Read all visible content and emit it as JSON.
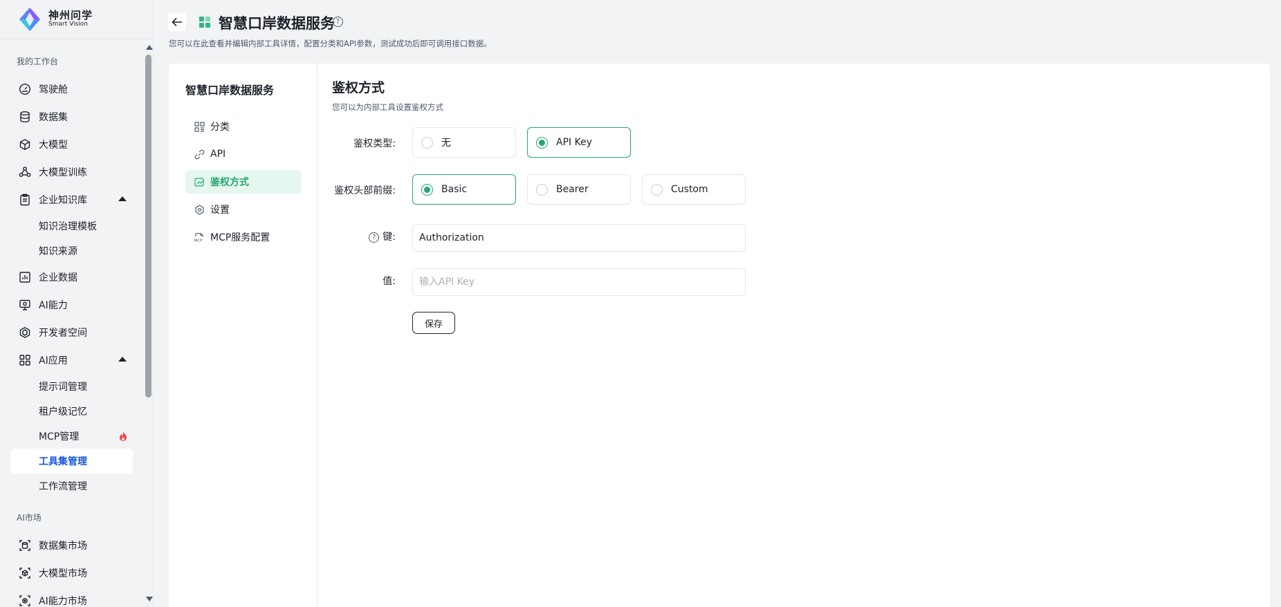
{
  "brand": {
    "name_cn": "神州问学",
    "name_en": "Smart Vision"
  },
  "sidebar": {
    "section_workspace": "我的工作台",
    "items": [
      {
        "label": "驾驶舱",
        "icon": "dashboard-icon"
      },
      {
        "label": "数据集",
        "icon": "database-icon"
      },
      {
        "label": "大模型",
        "icon": "cube-icon"
      },
      {
        "label": "大模型训练",
        "icon": "training-icon"
      },
      {
        "label": "企业知识库",
        "icon": "clipboard-icon"
      },
      {
        "label": "企业数据",
        "icon": "bar-chart-icon"
      },
      {
        "label": "AI能力",
        "icon": "monitor-icon"
      },
      {
        "label": "开发者空间",
        "icon": "hexagon-icon"
      },
      {
        "label": "AI应用",
        "icon": "apps-grid-icon"
      }
    ],
    "knowledge_sub": [
      "知识治理模板",
      "知识来源"
    ],
    "ai_app_sub": [
      "提示词管理",
      "租户级记忆",
      "MCP管理",
      "工具集管理",
      "工作流管理"
    ],
    "section_market": "AI市场",
    "market_items": [
      {
        "label": "数据集市场",
        "icon": "dataset-market-icon"
      },
      {
        "label": "大模型市场",
        "icon": "model-market-icon"
      },
      {
        "label": "AI能力市场",
        "icon": "ai-market-icon"
      }
    ]
  },
  "header": {
    "title": "智慧口岸数据服务",
    "subtitle": "您可以在此查看并编辑内部工具详情，配置分类和API参数，测试成功后即可调用接口数据。"
  },
  "inner_nav": {
    "title": "智慧口岸数据服务",
    "tabs": [
      {
        "label": "分类",
        "icon": "category-icon"
      },
      {
        "label": "API",
        "icon": "api-link-icon"
      },
      {
        "label": "鉴权方式",
        "icon": "auth-icon"
      },
      {
        "label": "设置",
        "icon": "settings-icon"
      },
      {
        "label": "MCP服务配置",
        "icon": "mcp-icon"
      }
    ],
    "active_tab": "鉴权方式"
  },
  "form": {
    "title": "鉴权方式",
    "description": "您可以为内部工具设置鉴权方式",
    "auth_type_label": "鉴权类型:",
    "auth_type_options": [
      "无",
      "API Key"
    ],
    "auth_type_selected": "API Key",
    "header_prefix_label": "鉴权头部前缀:",
    "header_prefix_options": [
      "Basic",
      "Bearer",
      "Custom"
    ],
    "header_prefix_selected": "Basic",
    "key_label": "键:",
    "key_value": "Authorization",
    "value_label": "值:",
    "value_placeholder": "输入API Key",
    "save_label": "保存"
  },
  "colors": {
    "accent_green": "#23a86f",
    "active_blue": "#1a5ad8",
    "fire_red": "#f53f3f"
  }
}
